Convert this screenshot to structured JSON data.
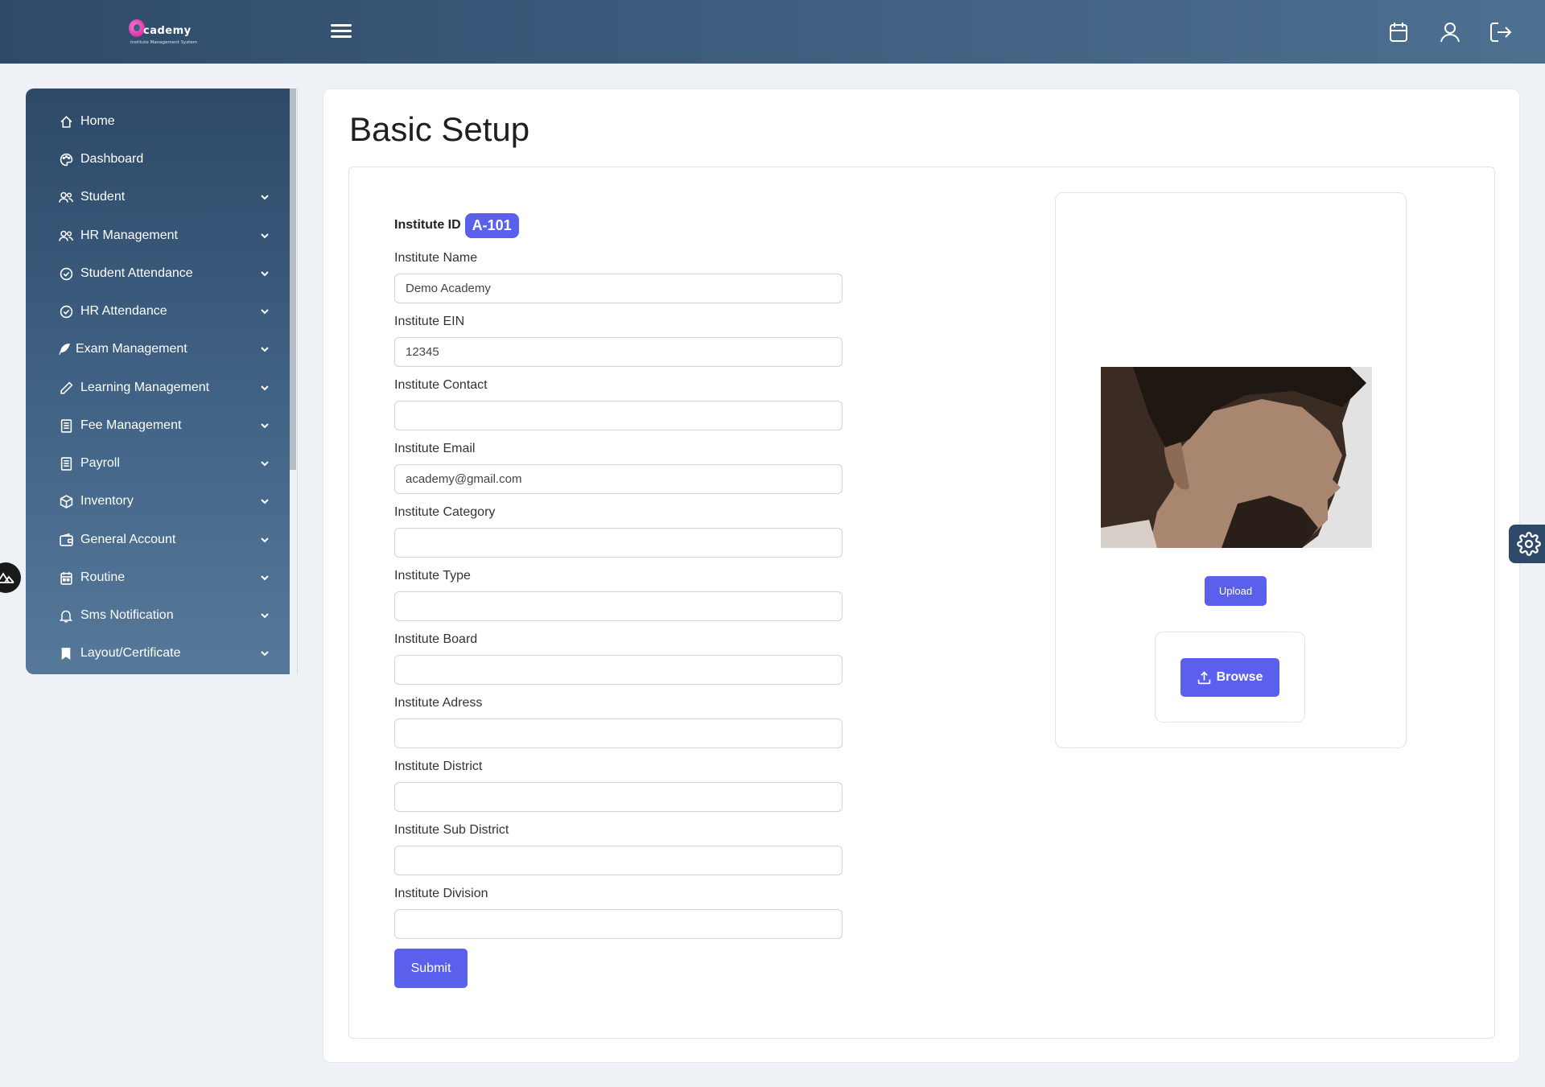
{
  "app": {
    "logo_text": "cademy",
    "logo_subtitle": "Institute Management System"
  },
  "header": {
    "icons": [
      "menu-icon",
      "calendar-icon",
      "user-icon",
      "logout-icon"
    ]
  },
  "sidebar": {
    "items": [
      {
        "label": "Home",
        "icon": "home-icon",
        "expandable": false
      },
      {
        "label": "Dashboard",
        "icon": "palette-icon",
        "expandable": false
      },
      {
        "label": "Student",
        "icon": "users-icon",
        "expandable": true
      },
      {
        "label": "HR Management",
        "icon": "users-icon",
        "expandable": true
      },
      {
        "label": "Student Attendance",
        "icon": "check-circle-icon",
        "expandable": true
      },
      {
        "label": "HR Attendance",
        "icon": "check-circle-icon",
        "expandable": true
      },
      {
        "label": "Exam Management",
        "icon": "feather-icon",
        "expandable": true
      },
      {
        "label": "Learning Management",
        "icon": "pencil-icon",
        "expandable": true
      },
      {
        "label": "Fee Management",
        "icon": "receipt-icon",
        "expandable": true
      },
      {
        "label": "Payroll",
        "icon": "receipt-icon",
        "expandable": true
      },
      {
        "label": "Inventory",
        "icon": "box-icon",
        "expandable": true
      },
      {
        "label": "General Account",
        "icon": "wallet-icon",
        "expandable": true
      },
      {
        "label": "Routine",
        "icon": "calendar-icon",
        "expandable": true
      },
      {
        "label": "Sms Notification",
        "icon": "bell-icon",
        "expandable": true
      },
      {
        "label": "Layout/Certificate",
        "icon": "bookmark-icon",
        "expandable": true
      }
    ]
  },
  "page": {
    "title": "Basic Setup"
  },
  "form": {
    "institute_id_label": "Institute ID",
    "institute_id": "A-101",
    "fields": [
      {
        "label": "Institute Name",
        "value": "Demo Academy"
      },
      {
        "label": "Institute EIN",
        "value": "12345"
      },
      {
        "label": "Institute Contact",
        "value": ""
      },
      {
        "label": "Institute Email",
        "value": "academy@gmail.com"
      },
      {
        "label": "Institute Category",
        "value": ""
      },
      {
        "label": "Institute Type",
        "value": ""
      },
      {
        "label": "Institute Board",
        "value": ""
      },
      {
        "label": "Institute Adress",
        "value": ""
      },
      {
        "label": "Institute District",
        "value": ""
      },
      {
        "label": "Institute Sub District",
        "value": ""
      },
      {
        "label": "Institute Division",
        "value": ""
      }
    ],
    "submit_label": "Submit"
  },
  "photo_panel": {
    "upload_label": "Upload",
    "browse_label": "Browse"
  },
  "colors": {
    "accent": "#5a5fec",
    "sidebar_top": "#2e4968",
    "sidebar_bottom": "#56799a",
    "header": "#3e5e80"
  }
}
